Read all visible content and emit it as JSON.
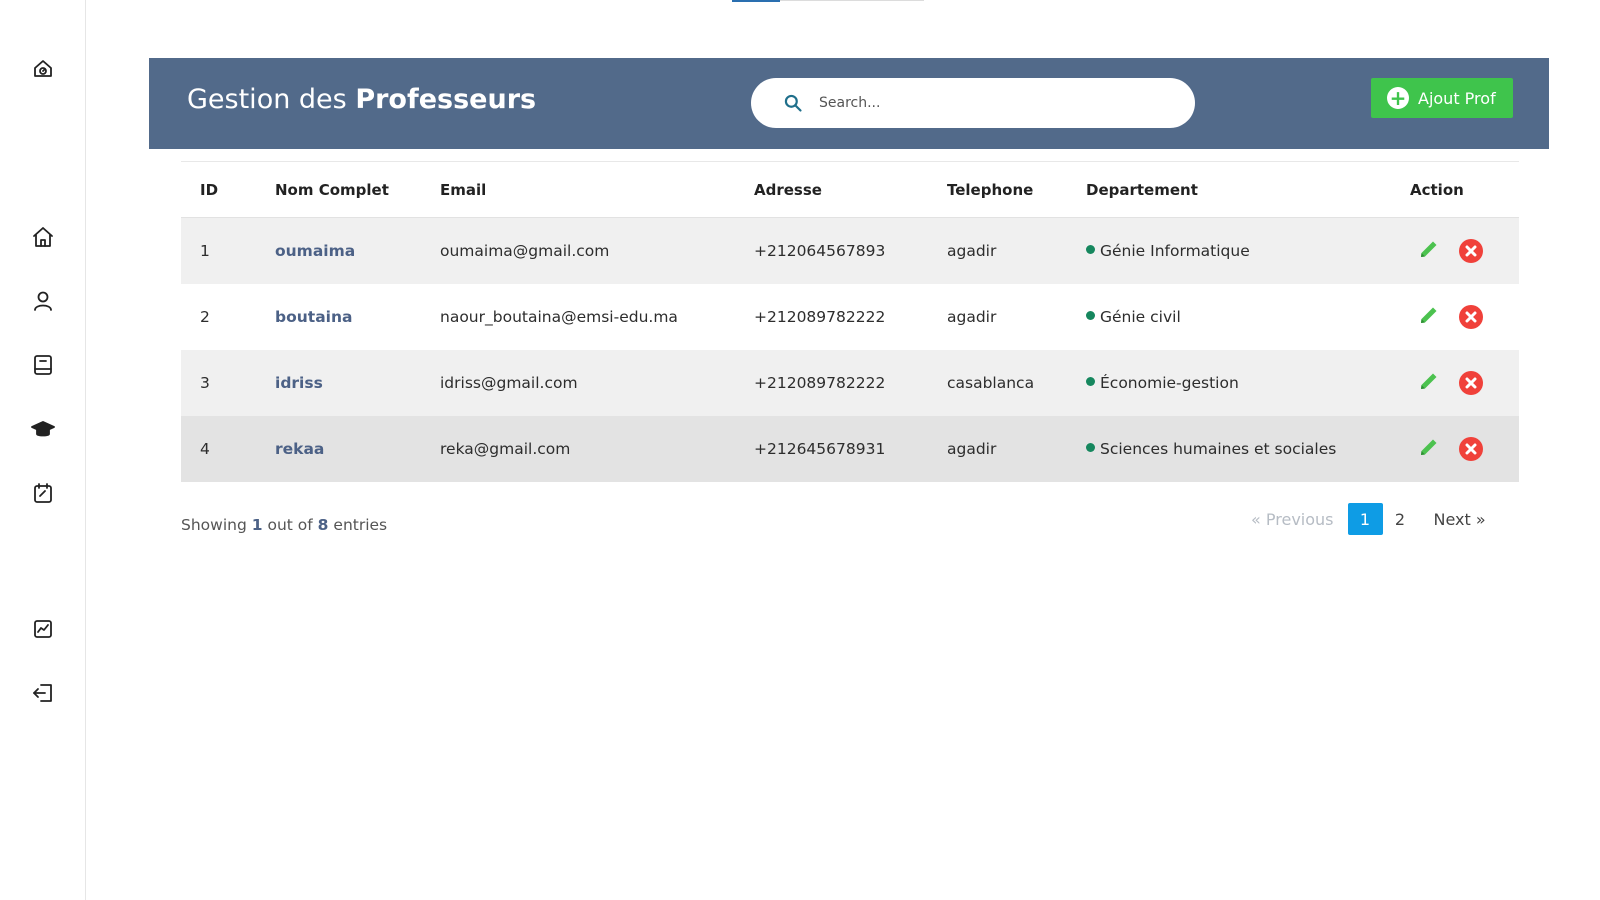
{
  "header": {
    "title_light": "Gestion des",
    "title_bold": "Professeurs",
    "search_placeholder": "Search...",
    "add_button": "Ajout Prof",
    "add_icon": "+"
  },
  "sidebar": {
    "icons": [
      "dashboard-icon",
      "home-icon",
      "user-icon",
      "book-icon",
      "graduation-cap-icon",
      "calendar-check-icon",
      "chart-icon",
      "logout-icon"
    ]
  },
  "table": {
    "columns": [
      "ID",
      "Nom Complet",
      "Email",
      "Adresse",
      "Telephone",
      "Departement",
      "Action"
    ],
    "rows": [
      {
        "id": "1",
        "name": "oumaima",
        "email": "oumaima@gmail.com",
        "adresse": "+212064567893",
        "telephone": "agadir",
        "departement": "Génie Informatique"
      },
      {
        "id": "2",
        "name": "boutaina",
        "email": "naour_boutaina@emsi-edu.ma",
        "adresse": "+212089782222",
        "telephone": "agadir",
        "departement": "Génie civil"
      },
      {
        "id": "3",
        "name": "idriss",
        "email": "idriss@gmail.com",
        "adresse": "+212089782222",
        "telephone": "casablanca",
        "departement": "Économie-gestion"
      },
      {
        "id": "4",
        "name": "rekaa",
        "email": "reka@gmail.com",
        "adresse": "+212645678931",
        "telephone": "agadir",
        "departement": "Sciences humaines et sociales"
      }
    ]
  },
  "footer": {
    "showing_prefix": "Showing",
    "showing_current": "1",
    "showing_middle": "out of",
    "showing_total": "8",
    "showing_suffix": "entries"
  },
  "pagination": {
    "prev": "«  Previous",
    "pages": [
      "1",
      "2"
    ],
    "active_page": "1",
    "next": "Next  »"
  },
  "colors": {
    "banner": "#526a8a",
    "add_button": "#3fc44c",
    "dept_dot": "#16875e",
    "delete": "#f0413a",
    "edit": "#4cc24f",
    "active_page": "#0e9ce5"
  }
}
